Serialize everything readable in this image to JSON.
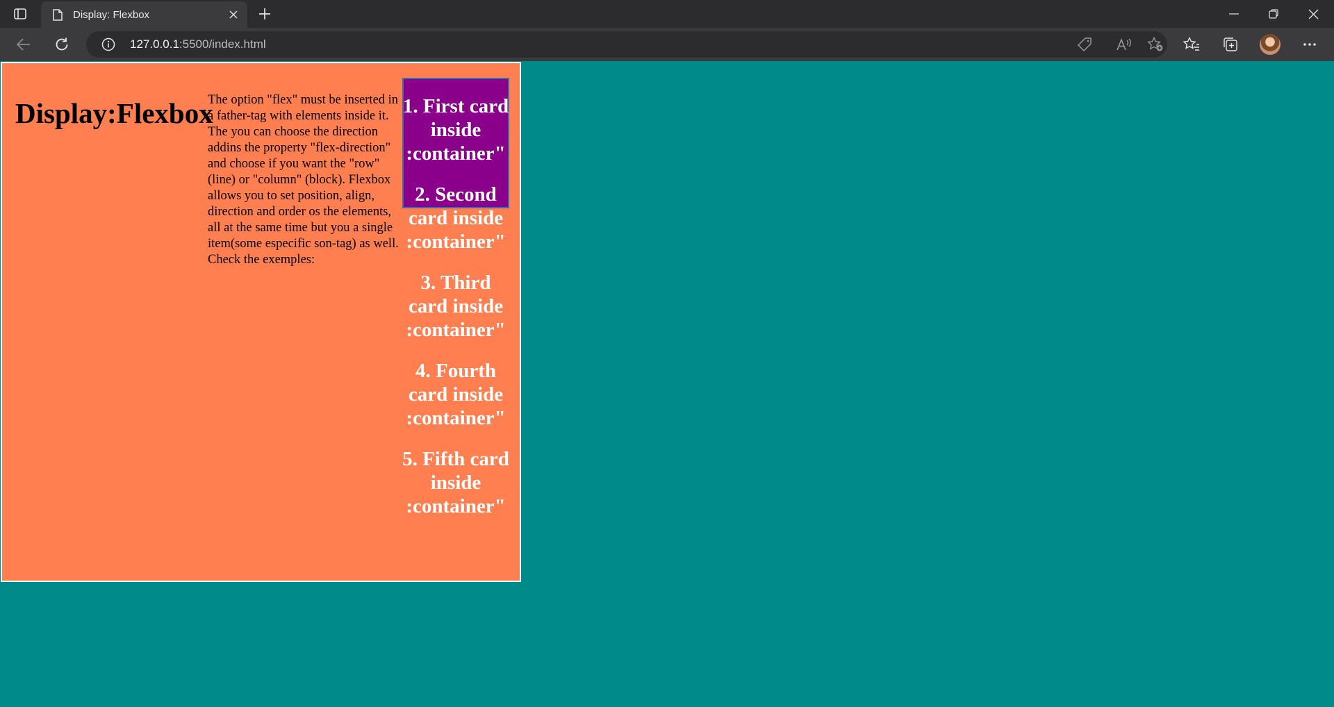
{
  "browser": {
    "tab_title": "Display: Flexbox",
    "url_host": "127.0.0.1",
    "url_rest": ":5500/index.html",
    "icons": {
      "tab_actions": "tab-actions-icon",
      "page": "page-icon",
      "close_tab": "close-icon",
      "new_tab": "plus-icon",
      "minimize": "minimize-icon",
      "restore": "restore-icon",
      "close_window": "close-icon",
      "back": "arrow-left-icon",
      "refresh": "refresh-icon",
      "site_info": "info-icon",
      "shopping": "tag-icon",
      "read_aloud": "read-aloud-icon",
      "add_favorite": "star-plus-icon",
      "favorites": "favorites-icon",
      "collections": "collections-icon",
      "menu": "more-icon"
    }
  },
  "page": {
    "background": "#008b8b",
    "container_background": "#ff7f50",
    "first_card_background": "#8b008b",
    "heading": "Display:Flexbox",
    "description": "The option \"flex\" must be inserted in a father-tag with elements inside it. The you can choose the direction addins the property \"flex-direction\" and choose if you want the \"row\"(line) or \"column\" (block). Flexbox allows you to set position, align, direction and order os the elements, all at the same time but you a single item(some especific son-tag) as well. Check the exemples:",
    "cards": [
      "1. First card inside :container\"",
      "2. Second card inside :container\"",
      "3. Third card inside :container\"",
      "4. Fourth card inside :container\"",
      "5. Fifth card inside :container\""
    ]
  }
}
